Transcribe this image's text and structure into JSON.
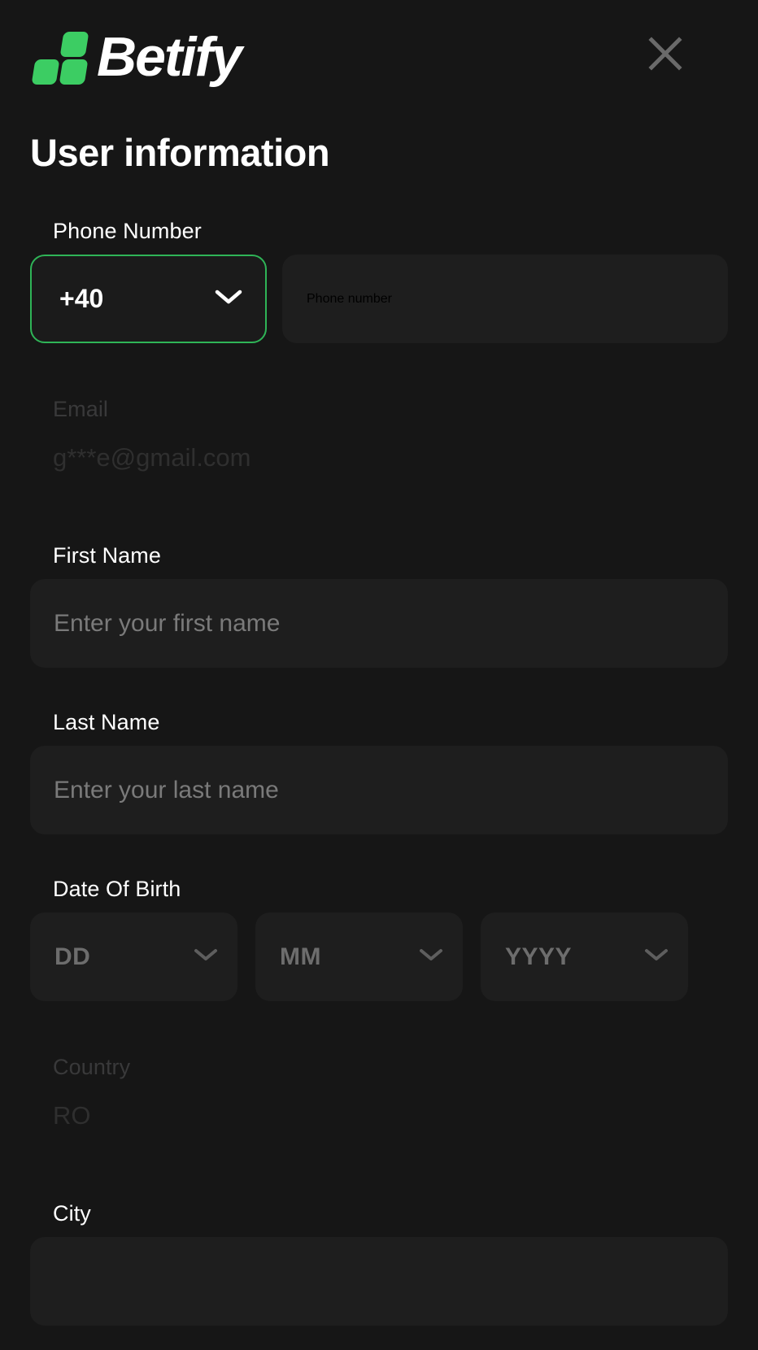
{
  "brand": {
    "name": "Betify",
    "logo_icon": "betify-squares-logo",
    "logo_color": "#3ccd63"
  },
  "header": {
    "close_icon": "close-icon",
    "close_color": "#6a6a6a"
  },
  "page": {
    "title": "User information",
    "background_color": "#161616",
    "field_background_color": "#1e1e1e",
    "accent_color": "#2fb457"
  },
  "form": {
    "phone": {
      "label": "Phone Number",
      "country_code": "+40",
      "country_code_chevron_icon": "chevron-down-icon",
      "input_placeholder": "Phone number",
      "input_value": ""
    },
    "email": {
      "label": "Email",
      "value": "g***e@gmail.com",
      "disabled": true
    },
    "first_name": {
      "label": "First Name",
      "placeholder": "Enter your first name",
      "value": ""
    },
    "last_name": {
      "label": "Last Name",
      "placeholder": "Enter your last name",
      "value": ""
    },
    "date_of_birth": {
      "label": "Date Of Birth",
      "day": {
        "value": "DD",
        "chevron_icon": "chevron-down-icon"
      },
      "month": {
        "value": "MM",
        "chevron_icon": "chevron-down-icon"
      },
      "year": {
        "value": "YYYY",
        "chevron_icon": "chevron-down-icon"
      }
    },
    "country": {
      "label": "Country",
      "value": "RO",
      "disabled": true
    },
    "city": {
      "label": "City",
      "placeholder": "",
      "value": ""
    }
  }
}
